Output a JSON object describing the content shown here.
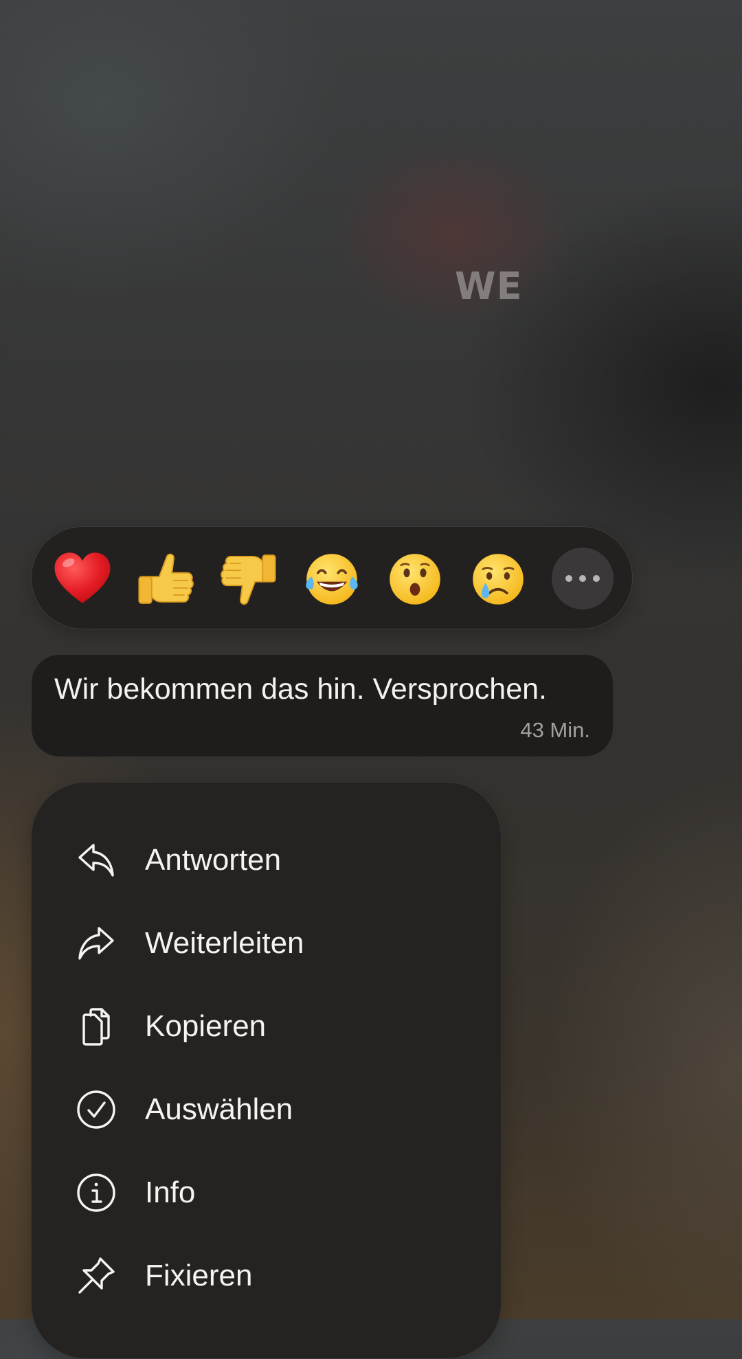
{
  "background": {
    "label": "WE"
  },
  "reactions": {
    "items": [
      {
        "name": "red-heart",
        "emoji": "❤️"
      },
      {
        "name": "thumbs-up",
        "emoji": "👍"
      },
      {
        "name": "thumbs-down",
        "emoji": "👎"
      },
      {
        "name": "face-with-tears-of-joy",
        "emoji": "😂"
      },
      {
        "name": "hushed-face",
        "emoji": "😮"
      },
      {
        "name": "crying-face",
        "emoji": "😢"
      }
    ],
    "more_icon": "more-horizontal-icon"
  },
  "message": {
    "text": "Wir bekommen das hin. Versprochen.",
    "time": "43 Min."
  },
  "menu": {
    "items": [
      {
        "label": "Antworten",
        "icon": "reply-icon"
      },
      {
        "label": "Weiterleiten",
        "icon": "forward-icon"
      },
      {
        "label": "Kopieren",
        "icon": "copy-icon"
      },
      {
        "label": "Auswählen",
        "icon": "select-check-icon"
      },
      {
        "label": "Info",
        "icon": "info-icon"
      },
      {
        "label": "Fixieren",
        "icon": "pin-icon"
      }
    ]
  },
  "colors": {
    "bubble": "#1f1d1c",
    "menu": "#252321",
    "text": "#f4f2ef",
    "timestamp": "#a29f9b"
  }
}
